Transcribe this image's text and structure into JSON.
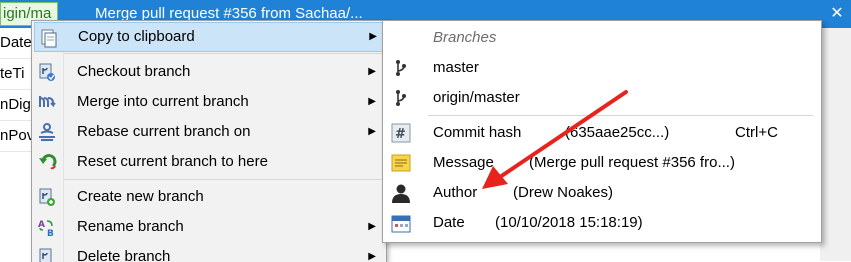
{
  "background": {
    "branch_pill": "igin/ma",
    "title": "Merge pull request #356 from Sachaa/...",
    "close_glyph": "✕",
    "rows": [
      "Date",
      "teTi",
      "nDig",
      "nPov"
    ]
  },
  "menu": {
    "items": [
      {
        "label": "Copy to clipboard",
        "icon": "clipboard-icon",
        "arrow": "▶"
      },
      {
        "label": "Checkout branch",
        "icon": "checkout-branch-icon",
        "arrow": "▶"
      },
      {
        "label": "Merge into current branch",
        "icon": "merge-icon",
        "arrow": "▶"
      },
      {
        "label": "Rebase current branch on",
        "icon": "rebase-icon",
        "arrow": "▶"
      },
      {
        "label": "Reset current branch to here",
        "icon": "reset-icon"
      },
      {
        "label": "Create new branch",
        "icon": "create-branch-icon"
      },
      {
        "label": "Rename branch",
        "icon": "rename-branch-icon",
        "arrow": "▶"
      },
      {
        "label": "Delete branch",
        "icon": "delete-branch-icon",
        "arrow": "▶"
      }
    ]
  },
  "submenu": {
    "header": "Branches",
    "branches": [
      "master",
      "origin/master"
    ],
    "commit_hash": {
      "label": "Commit hash",
      "value": "(635aae25cc...)",
      "shortcut": "Ctrl+C"
    },
    "message": {
      "label": "Message",
      "value": "(Merge pull request #356 fro...)"
    },
    "author": {
      "label": "Author",
      "value": "(Drew Noakes)"
    },
    "date": {
      "label": "Date",
      "value": "(10/10/2018 15:18:19)"
    }
  },
  "colors": {
    "highlight": "#cce4f7",
    "title_bar": "#1f82d6",
    "annotation_arrow": "#e8231e"
  }
}
